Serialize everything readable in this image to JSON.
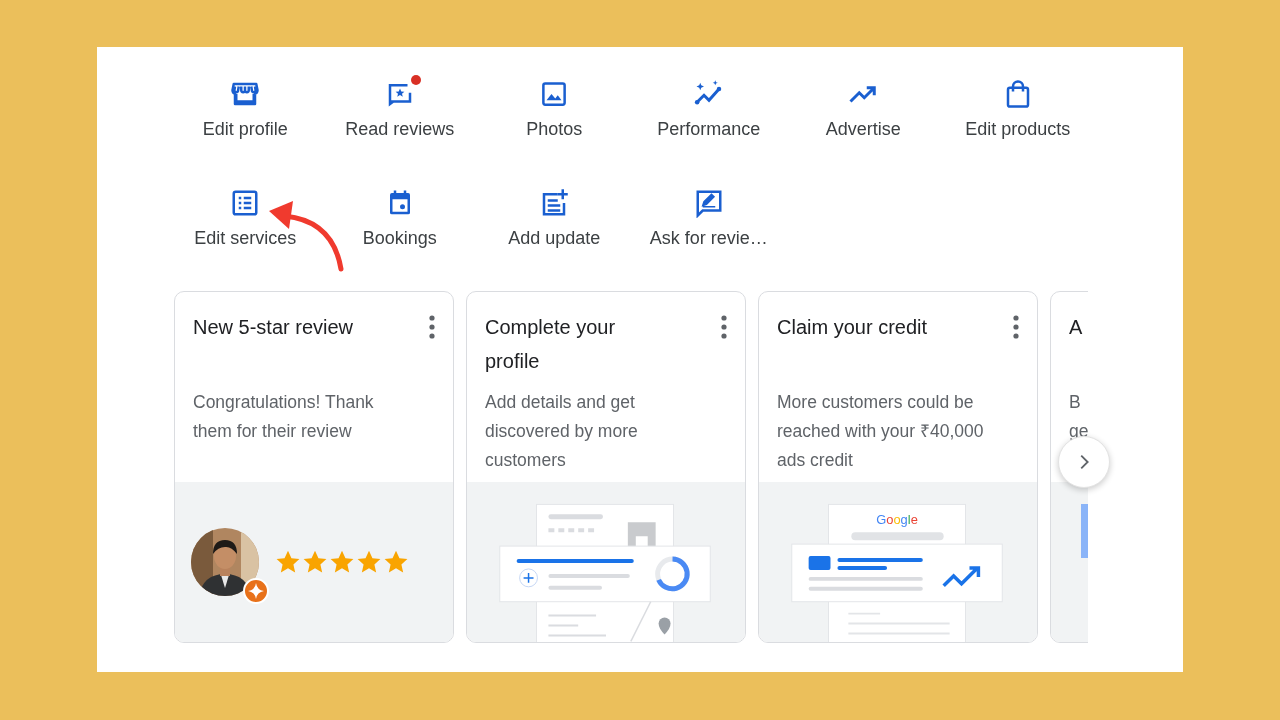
{
  "actions": [
    {
      "label": "Edit profile",
      "badge": false
    },
    {
      "label": "Read reviews",
      "badge": true
    },
    {
      "label": "Photos",
      "badge": false
    },
    {
      "label": "Performance",
      "badge": false
    },
    {
      "label": "Advertise",
      "badge": false
    },
    {
      "label": "Edit products",
      "badge": false
    },
    {
      "label": "Edit services",
      "badge": false
    },
    {
      "label": "Bookings",
      "badge": false
    },
    {
      "label": "Add update",
      "badge": false
    },
    {
      "label": "Ask for revie…",
      "badge": false
    }
  ],
  "cards": [
    {
      "kind": "review",
      "title": "New 5-star review",
      "description": "Congratulations! Thank them for their review",
      "stars": 5
    },
    {
      "kind": "profile",
      "title": "Complete your profile",
      "description": "Add details and get discovered by more customers"
    },
    {
      "kind": "credit",
      "title": "Claim your credit",
      "description": "More customers could be reached with your ₹40,000 ads credit",
      "logo": "Google"
    },
    {
      "kind": "partial",
      "title": "A",
      "description": "B ge"
    }
  ]
}
